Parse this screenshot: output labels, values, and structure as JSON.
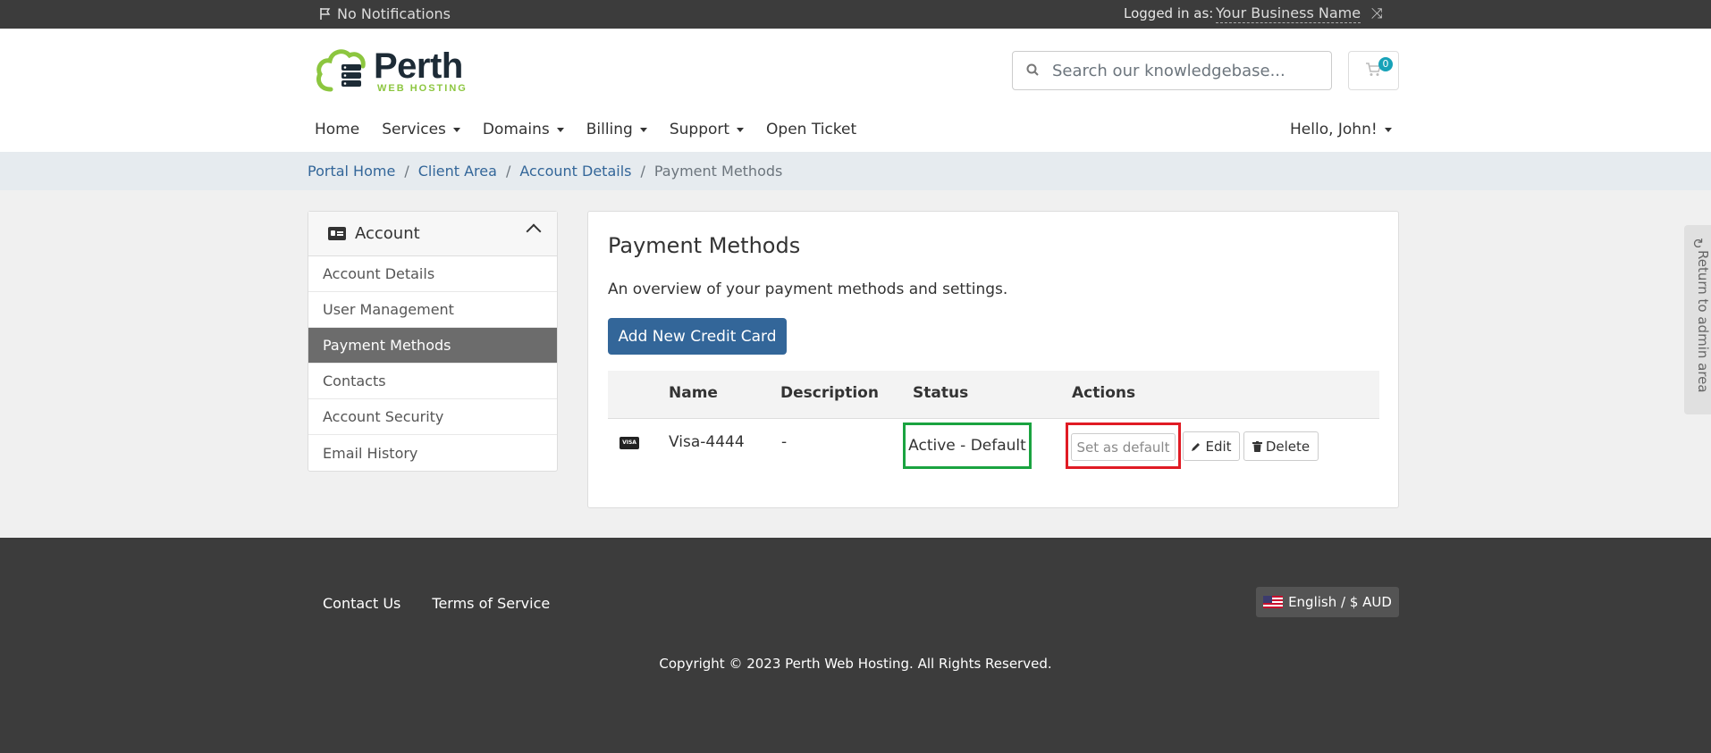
{
  "topbar": {
    "notifications": "No Notifications",
    "logged_in_label": "Logged in as:",
    "business_name": "Your Business Name"
  },
  "logo": {
    "name": "Perth",
    "tagline": "WEB HOSTING"
  },
  "search": {
    "placeholder": "Search our knowledgebase..."
  },
  "cart": {
    "count": "0"
  },
  "nav": {
    "items": [
      {
        "label": "Home"
      },
      {
        "label": "Services"
      },
      {
        "label": "Domains"
      },
      {
        "label": "Billing"
      },
      {
        "label": "Support"
      },
      {
        "label": "Open Ticket"
      }
    ],
    "user": "Hello, John!"
  },
  "breadcrumb": [
    "Portal Home",
    "Client Area",
    "Account Details",
    "Payment Methods"
  ],
  "sidebar": {
    "title": "Account",
    "items": [
      {
        "label": "Account Details"
      },
      {
        "label": "User Management"
      },
      {
        "label": "Payment Methods"
      },
      {
        "label": "Contacts"
      },
      {
        "label": "Account Security"
      },
      {
        "label": "Email History"
      }
    ]
  },
  "main": {
    "title": "Payment Methods",
    "description": "An overview of your payment methods and settings.",
    "add_button": "Add New Credit Card",
    "columns": [
      "Name",
      "Description",
      "Status",
      "Actions"
    ],
    "row": {
      "card_brand": "VISA",
      "name": "Visa-4444",
      "description": "-",
      "status": "Active - Default",
      "set_default": "Set as default",
      "edit": "Edit",
      "delete": "Delete"
    }
  },
  "admin_tab": "Return to admin area",
  "footer": {
    "links": [
      "Contact Us",
      "Terms of Service"
    ],
    "language": "English / $ AUD",
    "copyright": "Copyright © 2023 Perth Web Hosting. All Rights Reserved."
  },
  "colors": {
    "primary": "#336699",
    "logo_green": "#8cc63f",
    "status_highlight": "#1aa340",
    "action_highlight": "#e01b24"
  }
}
